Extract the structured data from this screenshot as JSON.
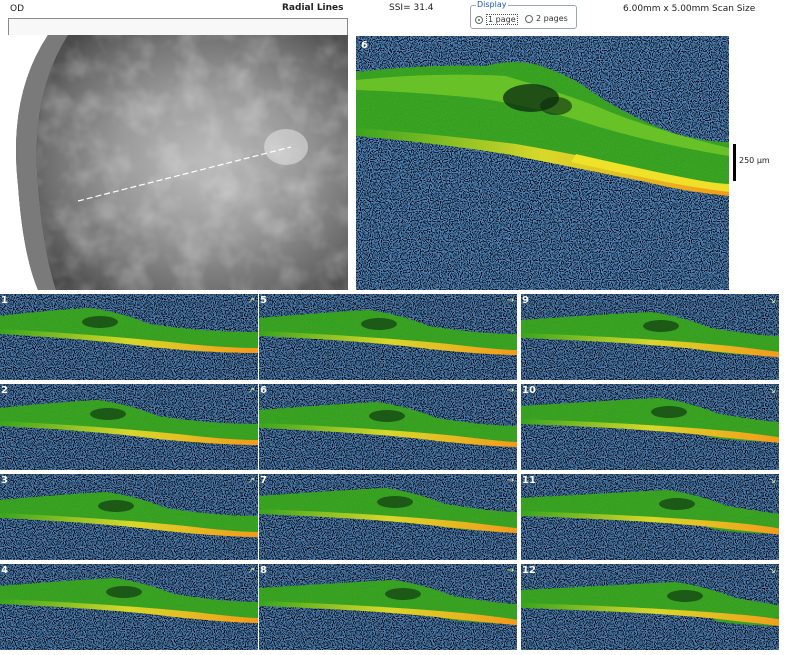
{
  "header": {
    "eye": "OD",
    "scan_type": "Radial Lines",
    "ssi": "SSI= 31.4",
    "scan_size": "6.00mm x 5.00mm Scan Size"
  },
  "display": {
    "legend": "Display",
    "options": [
      {
        "label": "1 page",
        "selected": true
      },
      {
        "label": "2 pages",
        "selected": false
      }
    ]
  },
  "main_scan": {
    "number": "6"
  },
  "scale": {
    "label": "250 µm"
  },
  "thumbnails": [
    {
      "number": "1",
      "arrow": "↗"
    },
    {
      "number": "2",
      "arrow": "↗"
    },
    {
      "number": "3",
      "arrow": "↗"
    },
    {
      "number": "4",
      "arrow": "↗"
    },
    {
      "number": "5",
      "arrow": "→"
    },
    {
      "number": "6",
      "arrow": "→"
    },
    {
      "number": "7",
      "arrow": "→"
    },
    {
      "number": "8",
      "arrow": "→"
    },
    {
      "number": "9",
      "arrow": "↘"
    },
    {
      "number": "10",
      "arrow": "↘"
    },
    {
      "number": "11",
      "arrow": "↘"
    },
    {
      "number": "12",
      "arrow": "↘"
    }
  ],
  "colors": {
    "retina_green": "#39a51e",
    "bright_yellow": "#f0e62a",
    "rpe_orange": "#f59a1a",
    "noise_blue": "#2a63a8",
    "background": "#02020a"
  }
}
